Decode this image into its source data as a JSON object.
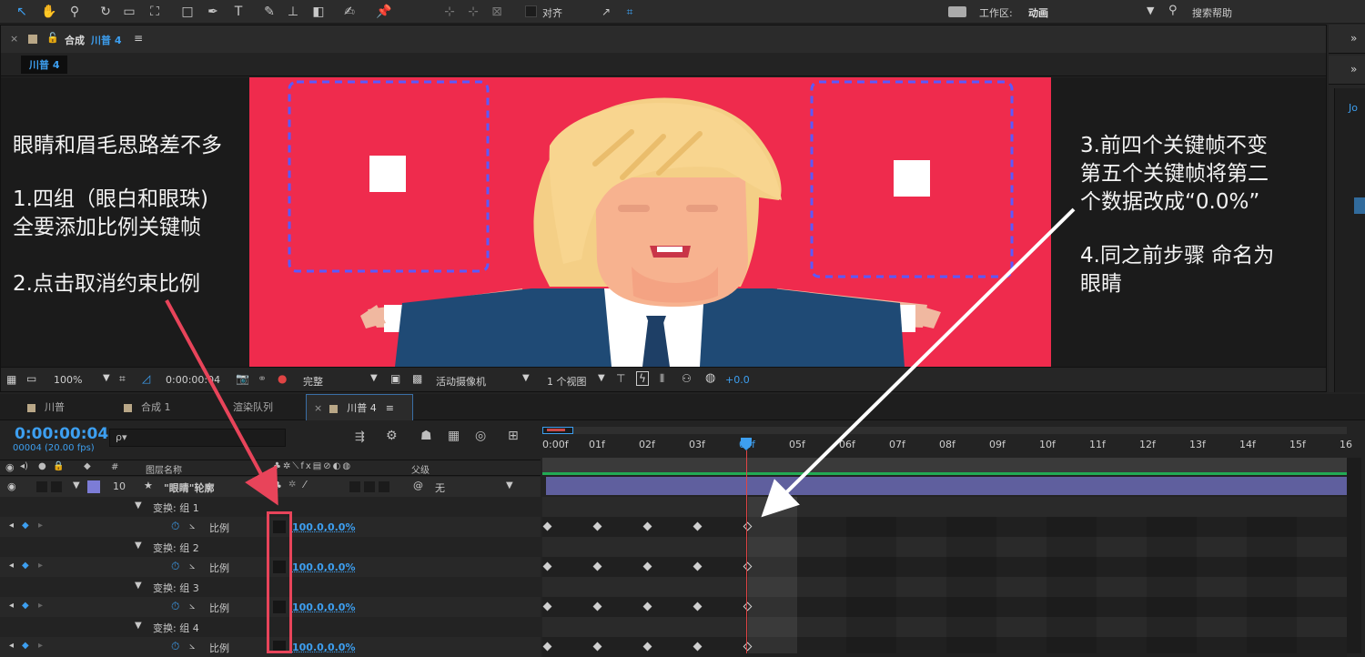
{
  "toolbar": {
    "align_label": "对齐",
    "workspace_label": "工作区:",
    "workspace_value": "动画",
    "search_label": "搜索帮助"
  },
  "comp_panel": {
    "title_prefix": "合成",
    "title_name": "川普 4",
    "menu_glyph": "≡",
    "breadcrumb": "川普 4"
  },
  "viewer_bar": {
    "zoom": "100%",
    "timecode": "0:00:00:04",
    "quality": "完整",
    "camera": "活动摄像机",
    "views": "1 个视图",
    "exposure": "+0.0"
  },
  "timeline": {
    "tabs": [
      {
        "label": "川普"
      },
      {
        "label": "合成 1"
      },
      {
        "label": "渲染队列"
      },
      {
        "label": "川普 4"
      }
    ],
    "timecode": "0:00:00:04",
    "frame_info": "00004 (20.00 fps)",
    "search_placeholder": "ρ▾",
    "col_hash": "#",
    "col_layer_name": "图层名称",
    "col_parent": "父级",
    "layer": {
      "number": "10",
      "name": "\"眼睛\"轮廓",
      "parent": "无"
    },
    "groups": [
      {
        "label": "变换: 组 1",
        "prop": "比例",
        "value": "100.0,0.0%"
      },
      {
        "label": "变换: 组 2",
        "prop": "比例",
        "value": "100.0,0.0%"
      },
      {
        "label": "变换: 组 3",
        "prop": "比例",
        "value": "100.0,0.0%"
      },
      {
        "label": "变换: 组 4",
        "prop": "比例",
        "value": "100.0,0.0%"
      }
    ],
    "ruler": [
      "0:00f",
      "01f",
      "02f",
      "03f",
      "04f",
      "05f",
      "06f",
      "07f",
      "08f",
      "09f",
      "10f",
      "11f",
      "12f",
      "13f",
      "14f",
      "15f",
      "16"
    ]
  },
  "annotations": {
    "left": [
      "眼睛和眉毛思路差不多",
      "1.四组（眼白和眼珠)",
      "全要添加比例关键帧",
      "2.点击取消约束比例"
    ],
    "right": [
      "3.前四个关键帧不变",
      "第五个关键帧将第二",
      "个数据改成“0.0%”",
      "4.同之前步骤 命名为",
      "眼睛"
    ]
  },
  "colors": {
    "accent": "#3d9ff0",
    "canvas_bg": "#ef2b4d",
    "highlight_red": "#e8445a",
    "layer_bar": "#5f5f9e",
    "layer_swatch": "#7c7cd6"
  }
}
